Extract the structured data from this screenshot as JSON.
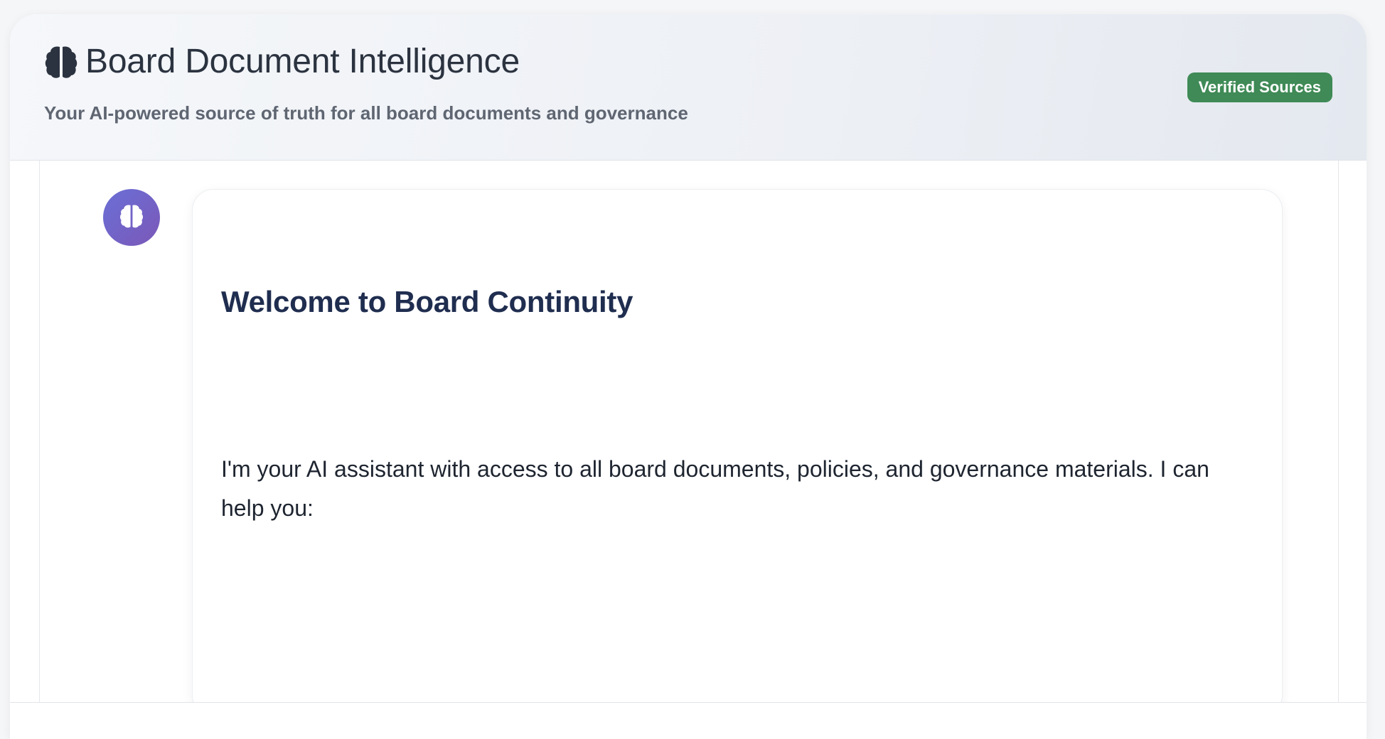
{
  "header": {
    "title": "Board Document Intelligence",
    "subtitle": "Your AI-powered source of truth for all board documents and governance",
    "badge": "Verified Sources",
    "title_icon": "brain-icon"
  },
  "colors": {
    "badge_bg": "#3f8a56",
    "avatar_gradient_start": "#6a6fd6",
    "avatar_gradient_end": "#7b58b8",
    "heading": "#1f2d4f"
  },
  "chat": {
    "assistant_avatar_icon": "brain-icon",
    "message": {
      "heading": "Welcome to Board Continuity",
      "body": "I'm your AI assistant with access to all board documents, policies, and governance materials. I can help you:"
    }
  }
}
